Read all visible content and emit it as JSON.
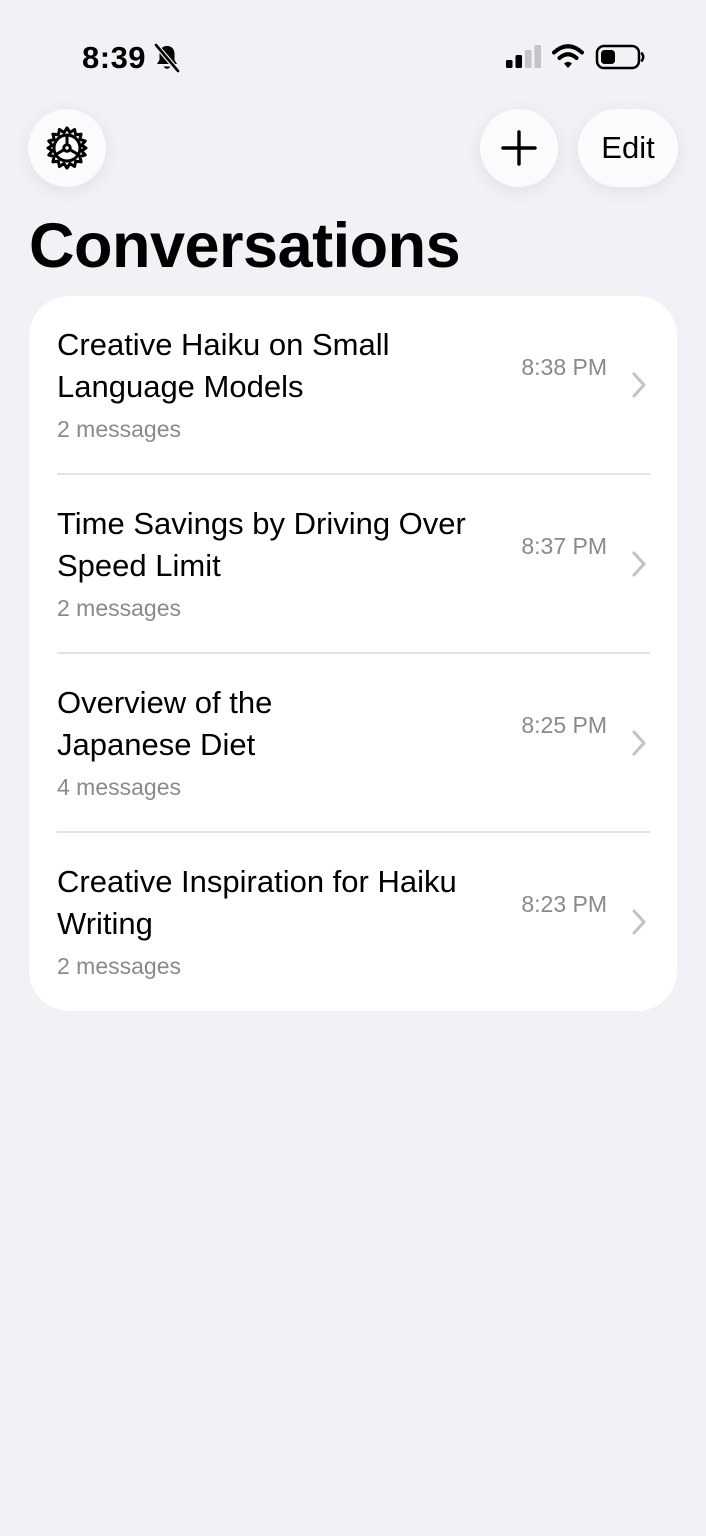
{
  "status_bar": {
    "time": "8:39",
    "icons": [
      "bell-slash-icon",
      "cellular-signal-icon",
      "wifi-icon",
      "battery-icon"
    ]
  },
  "toolbar": {
    "settings_icon": "gear-icon",
    "add_icon": "plus-icon",
    "edit_label": "Edit"
  },
  "page": {
    "title": "Conversations"
  },
  "conversations": [
    {
      "title": "Creative Haiku on Small Language Models",
      "messages": "2 messages",
      "time": "8:38 PM"
    },
    {
      "title": "Time Savings by Driving Over Speed Limit",
      "messages": "2 messages",
      "time": "8:37 PM"
    },
    {
      "title": "Overview of the Japanese Diet",
      "messages": "4 messages",
      "time": "8:25 PM"
    },
    {
      "title": "Creative Inspiration for Haiku Writing",
      "messages": "2 messages",
      "time": "8:23 PM"
    }
  ],
  "colors": {
    "background": "#f1f1f6",
    "card": "#ffffff",
    "secondary_text": "#8a8a8e",
    "divider": "#e3e3e7"
  }
}
